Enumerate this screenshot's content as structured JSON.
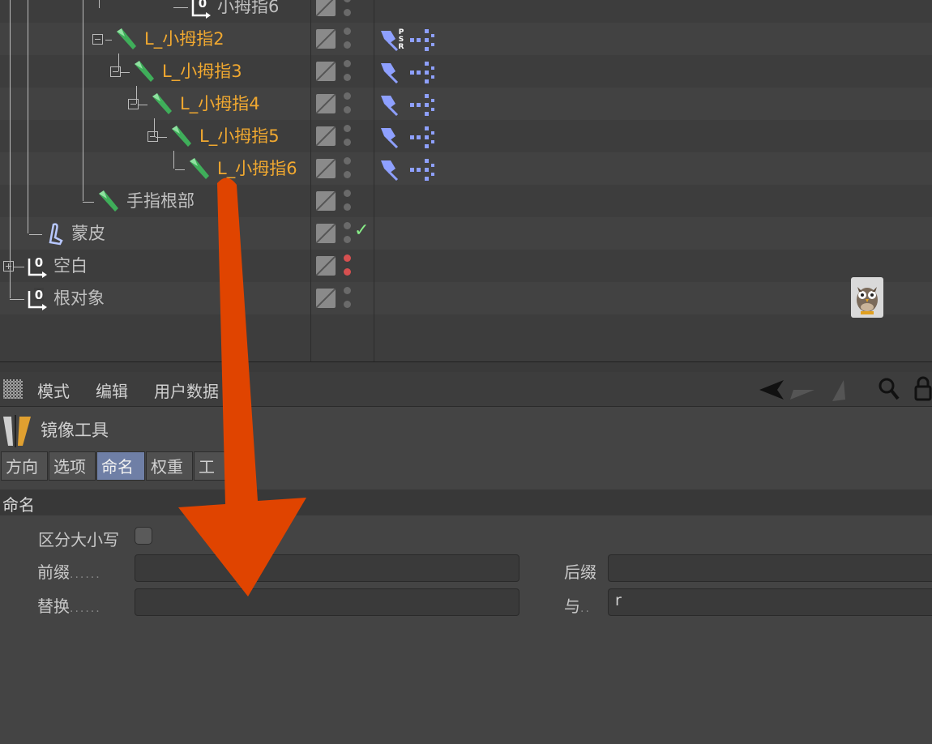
{
  "object_manager": {
    "rows": [
      {
        "label": "小拇指6",
        "style": "gray",
        "icon": "null-object-icon",
        "dots": "gray"
      },
      {
        "label": "L_小拇指2",
        "style": "orange",
        "icon": "joint-icon",
        "dots": "gray",
        "tags": [
          "psr-tag-icon",
          "constraint-tag-icon"
        ]
      },
      {
        "label": "L_小拇指3",
        "style": "orange",
        "icon": "joint-icon",
        "dots": "gray",
        "tags": [
          "pin-tag-icon",
          "constraint-tag-icon"
        ]
      },
      {
        "label": "L_小拇指4",
        "style": "orange",
        "icon": "joint-icon",
        "dots": "gray",
        "tags": [
          "pin-tag-icon",
          "constraint-tag-icon"
        ]
      },
      {
        "label": "L_小拇指5",
        "style": "orange",
        "icon": "joint-icon",
        "dots": "gray",
        "tags": [
          "pin-tag-icon",
          "constraint-tag-icon"
        ]
      },
      {
        "label": "L_小拇指6",
        "style": "orange",
        "icon": "joint-icon",
        "dots": "gray",
        "tags": [
          "pin-tag-icon",
          "constraint-tag-icon"
        ]
      },
      {
        "label": "手指根部",
        "style": "gray",
        "icon": "joint-icon",
        "dots": "gray"
      },
      {
        "label": "蒙皮",
        "style": "gray",
        "icon": "skin-icon",
        "dots": "gray",
        "checked": true
      },
      {
        "label": "空白",
        "style": "gray",
        "icon": "null-object-icon",
        "dots": "red"
      },
      {
        "label": "根对象",
        "style": "gray",
        "icon": "null-object-icon",
        "dots": "gray"
      }
    ],
    "null_badge": "0",
    "psr_letters": "PSR",
    "check_glyph": "✓"
  },
  "attribute_manager": {
    "menu": [
      "模式",
      "编辑",
      "用户数据"
    ],
    "tool_title": "镜像工具",
    "tabs": [
      {
        "label": "方向",
        "active": false
      },
      {
        "label": "选项",
        "active": false
      },
      {
        "label": "命名",
        "active": true
      },
      {
        "label": "权重",
        "active": false
      },
      {
        "label": "工",
        "active": false
      }
    ],
    "section": "命名",
    "case_sensitive_label": "区分大小写",
    "prefix_label": "前缀",
    "suffix_label": "后缀",
    "replace_label": "替换",
    "with_label": "与",
    "prefix_value": "",
    "suffix_value": "",
    "replace_value": "",
    "with_value": "r",
    "leader_long": "......",
    "leader_short": ".."
  },
  "colors": {
    "arrow": "#e04400",
    "orange_label": "#f0a830",
    "active_tab": "#6f7fa6"
  }
}
